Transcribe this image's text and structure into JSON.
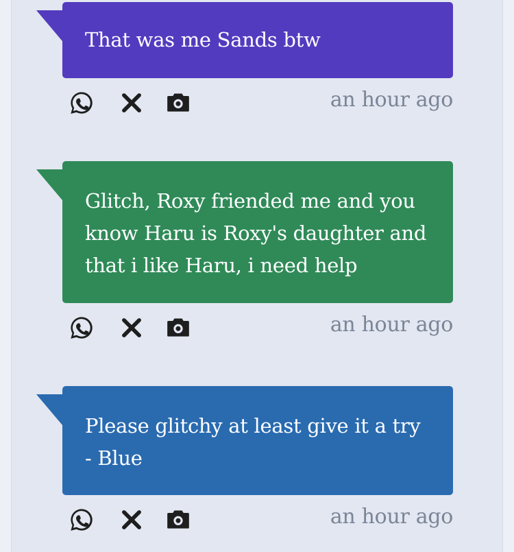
{
  "messages": [
    {
      "text": "That was me Sands btw",
      "color": "#533bbf",
      "time": "an hour ago"
    },
    {
      "text": "Glitch, Roxy friended me and you know Haru is Roxy's daughter and that i like Haru, i need help",
      "color": "#2f8a58",
      "time": "an hour ago"
    },
    {
      "text": "Please glitchy at least give it a try - Blue",
      "color": "#2a6bb0",
      "time": "an hour ago"
    }
  ],
  "icons": {
    "share": "whatsapp-icon",
    "close": "close-icon",
    "snapshot": "camera-icon"
  }
}
